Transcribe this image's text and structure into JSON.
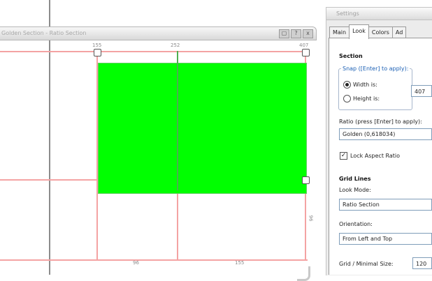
{
  "ruler_window": {
    "title": "Golden Section - Ratio Section",
    "buttons": [
      "▢",
      "?",
      "x"
    ],
    "labels": {
      "top_left": "155",
      "top_mid": "252",
      "top_right": "407",
      "right_side": "96",
      "bottom_left": "96",
      "bottom_right": "155"
    }
  },
  "settings": {
    "title": "Settings",
    "tabs": [
      "Main",
      "Look",
      "Colors",
      "Ad"
    ],
    "active_tab": "Look",
    "section_heading": "Section",
    "snap_caption": "Snap ([Enter] to apply):",
    "width_label": "Width is:",
    "width_value": "407",
    "height_label": "Height is:",
    "ratio_label": "Ratio (press [Enter] to apply):",
    "ratio_value": "Golden (0,618034)",
    "lock_aspect_label": "Lock Aspect Ratio",
    "lock_aspect_checked": true,
    "grid_heading": "Grid Lines",
    "look_mode_label": "Look Mode:",
    "look_mode_value": "Ratio Section",
    "orientation_label": "Orientation:",
    "orientation_value": "From Left and Top",
    "grid_size_label": "Grid / Minimal Size:",
    "grid_size_value": "120"
  },
  "colors": {
    "section_fill": "#00ff00",
    "guide_lines": "#f4a3a3"
  }
}
